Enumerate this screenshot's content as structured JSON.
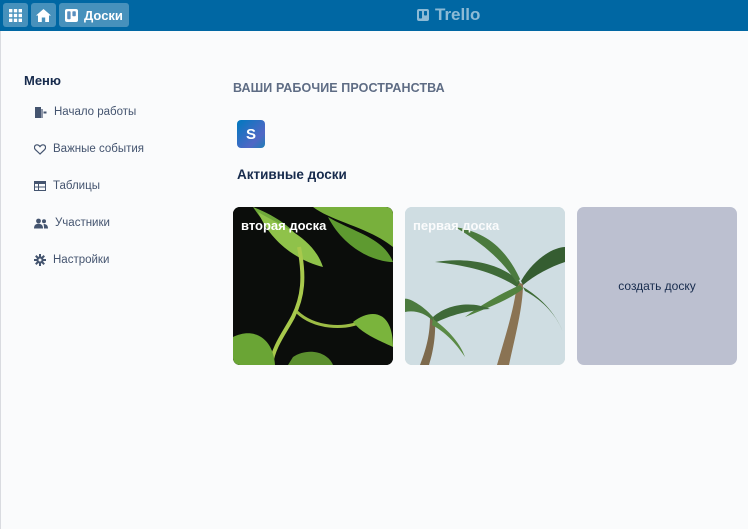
{
  "header": {
    "boards_label": "Доски",
    "logo_text": "Trello"
  },
  "menu": {
    "title": "Меню",
    "items": [
      {
        "label": "Начало работы",
        "icon": "getting-started-icon"
      },
      {
        "label": "Важные события",
        "icon": "heart-icon"
      },
      {
        "label": "Таблицы",
        "icon": "table-icon"
      },
      {
        "label": "Участники",
        "icon": "members-icon"
      },
      {
        "label": "Настройки",
        "icon": "gear-icon"
      }
    ]
  },
  "main": {
    "workspaces_heading": "ВАШИ РАБОЧИЕ ПРОСТРАНСТВА",
    "workspace_letter": "S",
    "active_boards_title": "Активные доски",
    "boards": [
      {
        "title": "вторая доска"
      },
      {
        "title": "первая доска"
      }
    ],
    "create_board_label": "создать доску"
  },
  "colors": {
    "topbar": "#0067a3",
    "create_tile": "#bcc0d0"
  }
}
